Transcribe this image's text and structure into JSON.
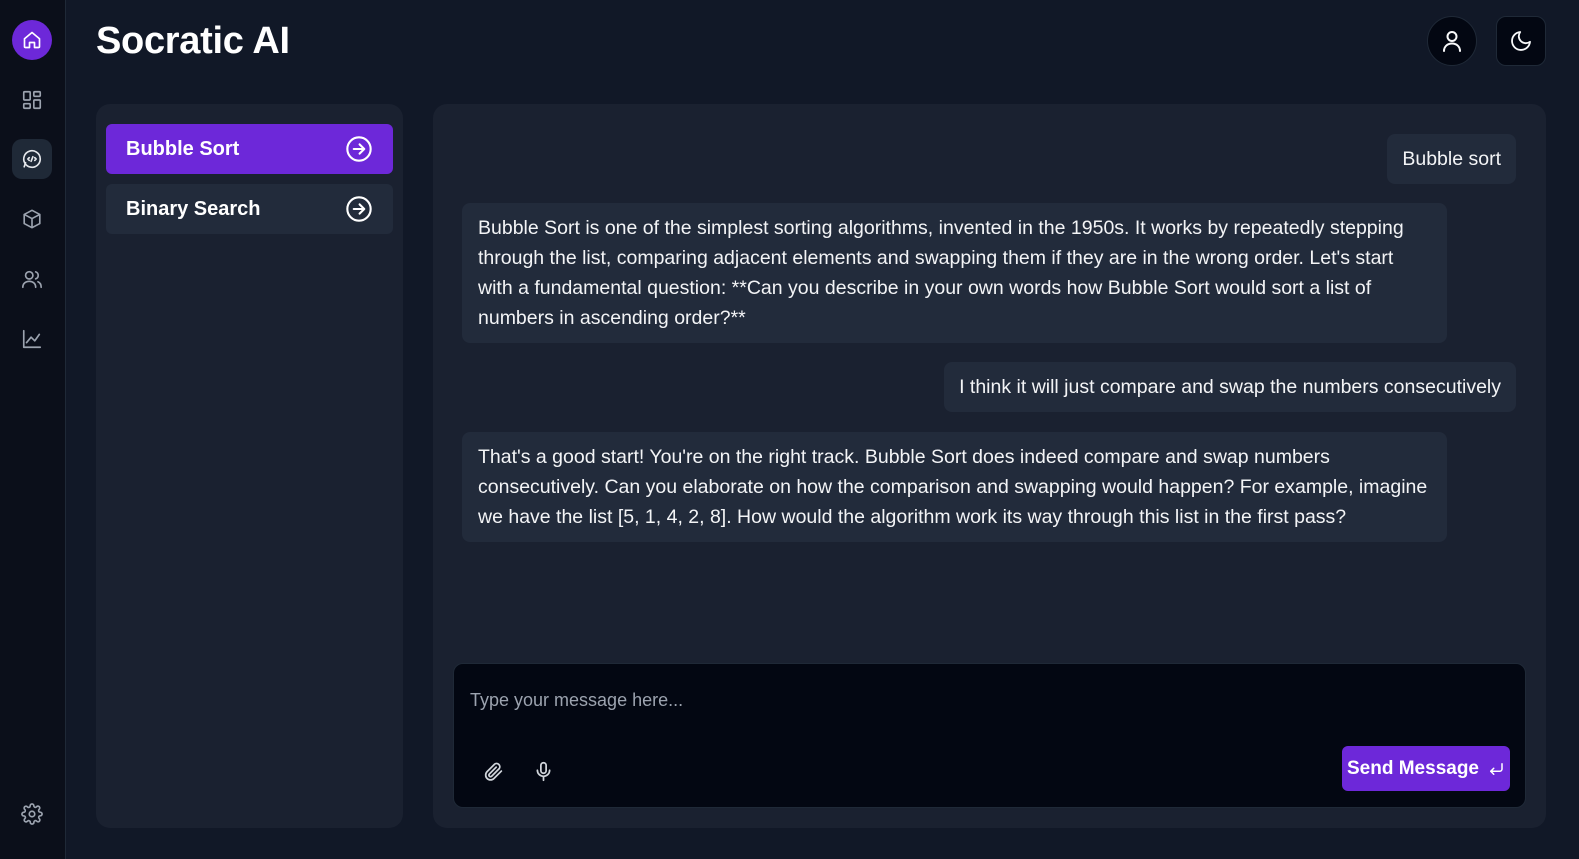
{
  "app": {
    "title": "Socratic AI"
  },
  "rail": {
    "items": [
      {
        "icon": "home-icon"
      },
      {
        "icon": "dashboard-icon"
      },
      {
        "icon": "chat-icon",
        "active": true
      },
      {
        "icon": "box-icon"
      },
      {
        "icon": "users-icon"
      },
      {
        "icon": "chart-icon"
      }
    ],
    "bottom": {
      "icon": "gear-icon"
    }
  },
  "header": {
    "profile_icon": "user-icon",
    "theme_icon": "moon-icon"
  },
  "topics": [
    {
      "label": "Bubble Sort",
      "active": true
    },
    {
      "label": "Binary Search",
      "active": false
    }
  ],
  "chat": {
    "messages": [
      {
        "role": "user",
        "text": "Bubble sort"
      },
      {
        "role": "ai",
        "text": "Bubble Sort is one of the simplest sorting algorithms, invented in the 1950s. It works by repeatedly stepping through the list, comparing adjacent elements and swapping them if they are in the wrong order. Let's start with a fundamental question: **Can you describe in your own words how Bubble Sort would sort a list of numbers in ascending order?**"
      },
      {
        "role": "user",
        "text": "I think it will just compare and swap the numbers consecutively"
      },
      {
        "role": "ai",
        "text": "That's a good start! You're on the right track. Bubble Sort does indeed compare and swap numbers consecutively. Can you elaborate on how the comparison and swapping would happen? For example, imagine we have the list [5, 1, 4, 2, 8]. How would the algorithm work its way through this list in the first pass?"
      }
    ]
  },
  "composer": {
    "placeholder": "Type your message here...",
    "value": "",
    "send_label": "Send Message"
  },
  "colors": {
    "accent": "#6d28d9",
    "background": "#111827",
    "panel": "#1a2130",
    "bubble": "#222b3b",
    "rail": "#0b0f1a"
  }
}
